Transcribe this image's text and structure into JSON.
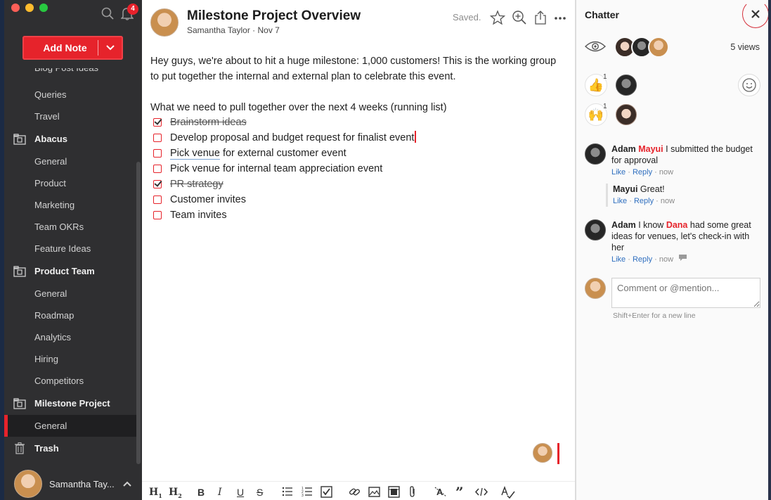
{
  "colors": {
    "accent": "#e6232b",
    "sidebar": "#2f2f31",
    "link": "#2f6fbf"
  },
  "sidebar": {
    "notification_count": "4",
    "add_note_label": "Add Note",
    "partial_item": "Blog Post Ideas",
    "items_top": [
      "Queries",
      "Travel"
    ],
    "groups": [
      {
        "name": "Abacus",
        "items": [
          "General",
          "Product",
          "Marketing",
          "Team OKRs",
          "Feature Ideas"
        ]
      },
      {
        "name": "Product Team",
        "items": [
          "General",
          "Roadmap",
          "Analytics",
          "Hiring",
          "Competitors"
        ]
      },
      {
        "name": "Milestone Project",
        "items": [
          "General"
        ]
      }
    ],
    "trash_label": "Trash",
    "user_name": "Samantha Tay..."
  },
  "note": {
    "title": "Milestone Project Overview",
    "meta": "Samantha Taylor · Nov 7",
    "status": "Saved.",
    "paragraph1": "Hey guys, we're about to hit a huge milestone: 1,000 customers! This is the working group to put together the internal and external plan to celebrate this event.",
    "paragraph2": "What we need to pull together over the next 4 weeks (running list)",
    "checklist": [
      {
        "text": "Brainstorm ideas",
        "done": true
      },
      {
        "text": "Develop proposal and budget request for finalist event",
        "done": false
      },
      {
        "text_link": "Pick venue",
        "text_rest": " for external customer event",
        "done": false
      },
      {
        "text": "Pick venue for internal team appreciation event",
        "done": false
      },
      {
        "text": "PR strategy",
        "done": true
      },
      {
        "text": "Customer invites",
        "done": false
      },
      {
        "text": "Team invites",
        "done": false
      }
    ],
    "format_bar": {
      "h1": "H",
      "h1_sub": "1",
      "h2": "H",
      "h2_sub": "2",
      "bold": "B",
      "italic": "I",
      "underline": "U",
      "strike": "S"
    }
  },
  "chatter": {
    "title": "Chatter",
    "views": "5 views",
    "reactions": [
      {
        "emoji": "👍",
        "count": "1"
      },
      {
        "emoji": "🙌",
        "count": "1"
      }
    ],
    "comments": [
      {
        "author": "Adam",
        "mention": "Mayui",
        "text": " I submitted the budget for approval",
        "actions": {
          "like": "Like",
          "sep1": " · ",
          "reply": "Reply",
          "sep2": " · ",
          "time": "now"
        }
      },
      {
        "author": "Mayui",
        "text": " Great!",
        "actions": {
          "like": "Like",
          "sep1": " · ",
          "reply": "Reply",
          "sep2": " · ",
          "time": "now"
        }
      },
      {
        "author": "Adam",
        "text_before": " I know ",
        "mention": "Dana",
        "text_after": " had some great ideas for venues, let's check-in with her",
        "actions": {
          "like": "Like",
          "sep1": " · ",
          "reply": "Reply",
          "sep2": " · ",
          "time": "now"
        }
      }
    ],
    "comment_placeholder": "Comment or @mention...",
    "hint": "Shift+Enter for a new line"
  }
}
